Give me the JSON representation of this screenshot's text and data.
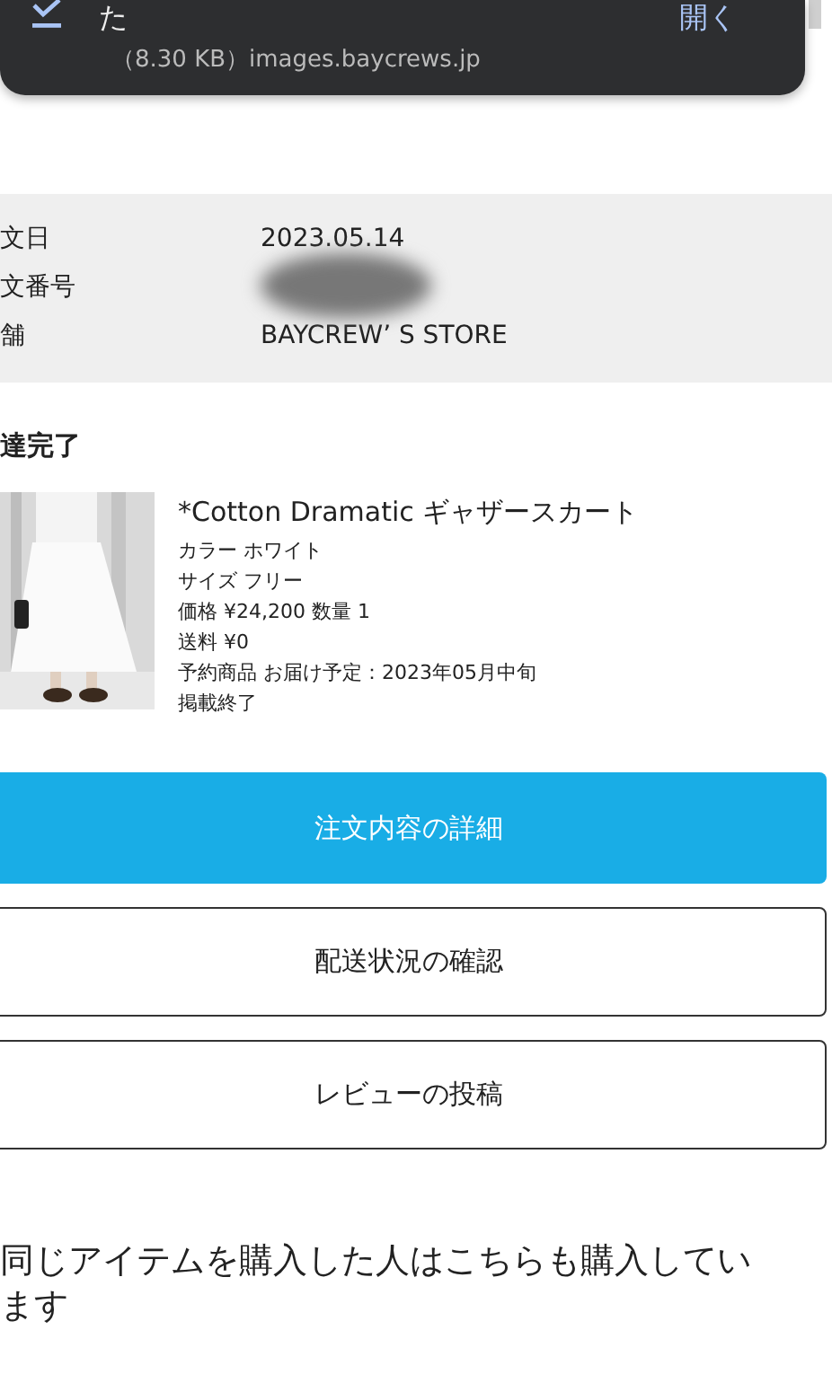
{
  "notification": {
    "title": "た",
    "detail": "（8.30 KB）images.baycrews.jp",
    "action": "開く"
  },
  "order_info": [
    {
      "label": "文日",
      "value": "2023.05.14",
      "redacted": false
    },
    {
      "label": "文番号",
      "redacted": true
    },
    {
      "label": "舗",
      "value": "BAYCREW’ S STORE",
      "redacted": false
    }
  ],
  "status": "達完了",
  "item": {
    "name": "*Cotton Dramatic ギャザースカート",
    "details": [
      "カラー ホワイト",
      "サイズ フリー",
      "価格 ¥24,200 数量 1",
      "送料 ¥0",
      "予約商品 お届け予定：2023年05月中旬",
      "掲載終了"
    ]
  },
  "buttons": [
    {
      "label": "注文内容の詳細",
      "kind": "primary"
    },
    {
      "label": "配送状況の確認",
      "kind": "outline"
    },
    {
      "label": "レビューの投稿",
      "kind": "outline"
    }
  ],
  "recommend_heading": "同じアイテムを購入した人はこちらも購入しています"
}
